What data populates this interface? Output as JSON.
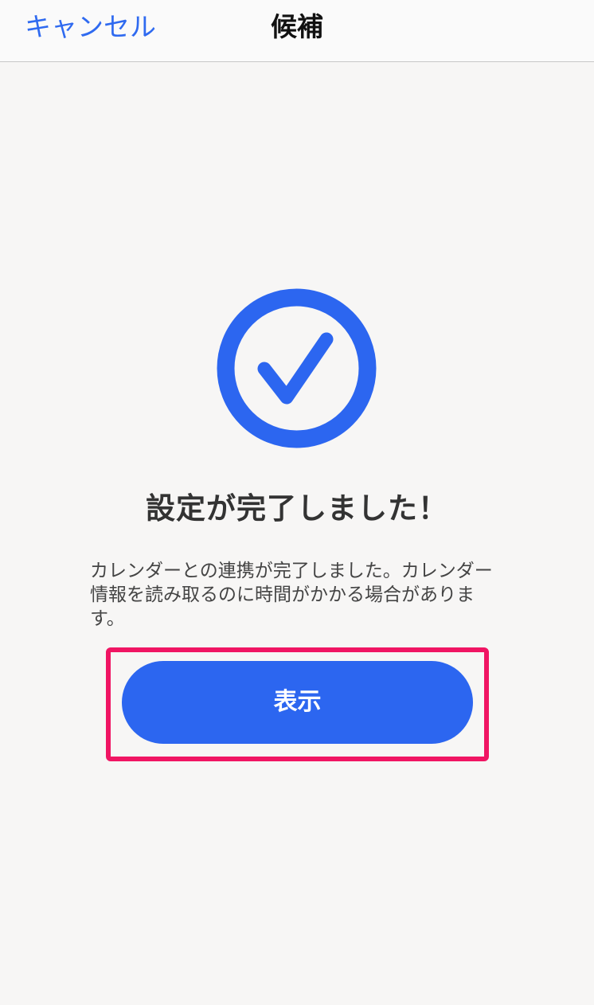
{
  "navbar": {
    "cancel_label": "キャンセル",
    "title": "候補"
  },
  "main": {
    "icon": "check-circle-icon",
    "heading": "設定が完了しました！",
    "description": "カレンダーとの連携が完了しました。カレンダー情報を読み取るのに時間がかかる場合があります。",
    "button_label": "表示"
  },
  "colors": {
    "accent": "#2c66f0",
    "link": "#2f6af0",
    "highlight": "#f01563",
    "background": "#f7f6f5"
  }
}
